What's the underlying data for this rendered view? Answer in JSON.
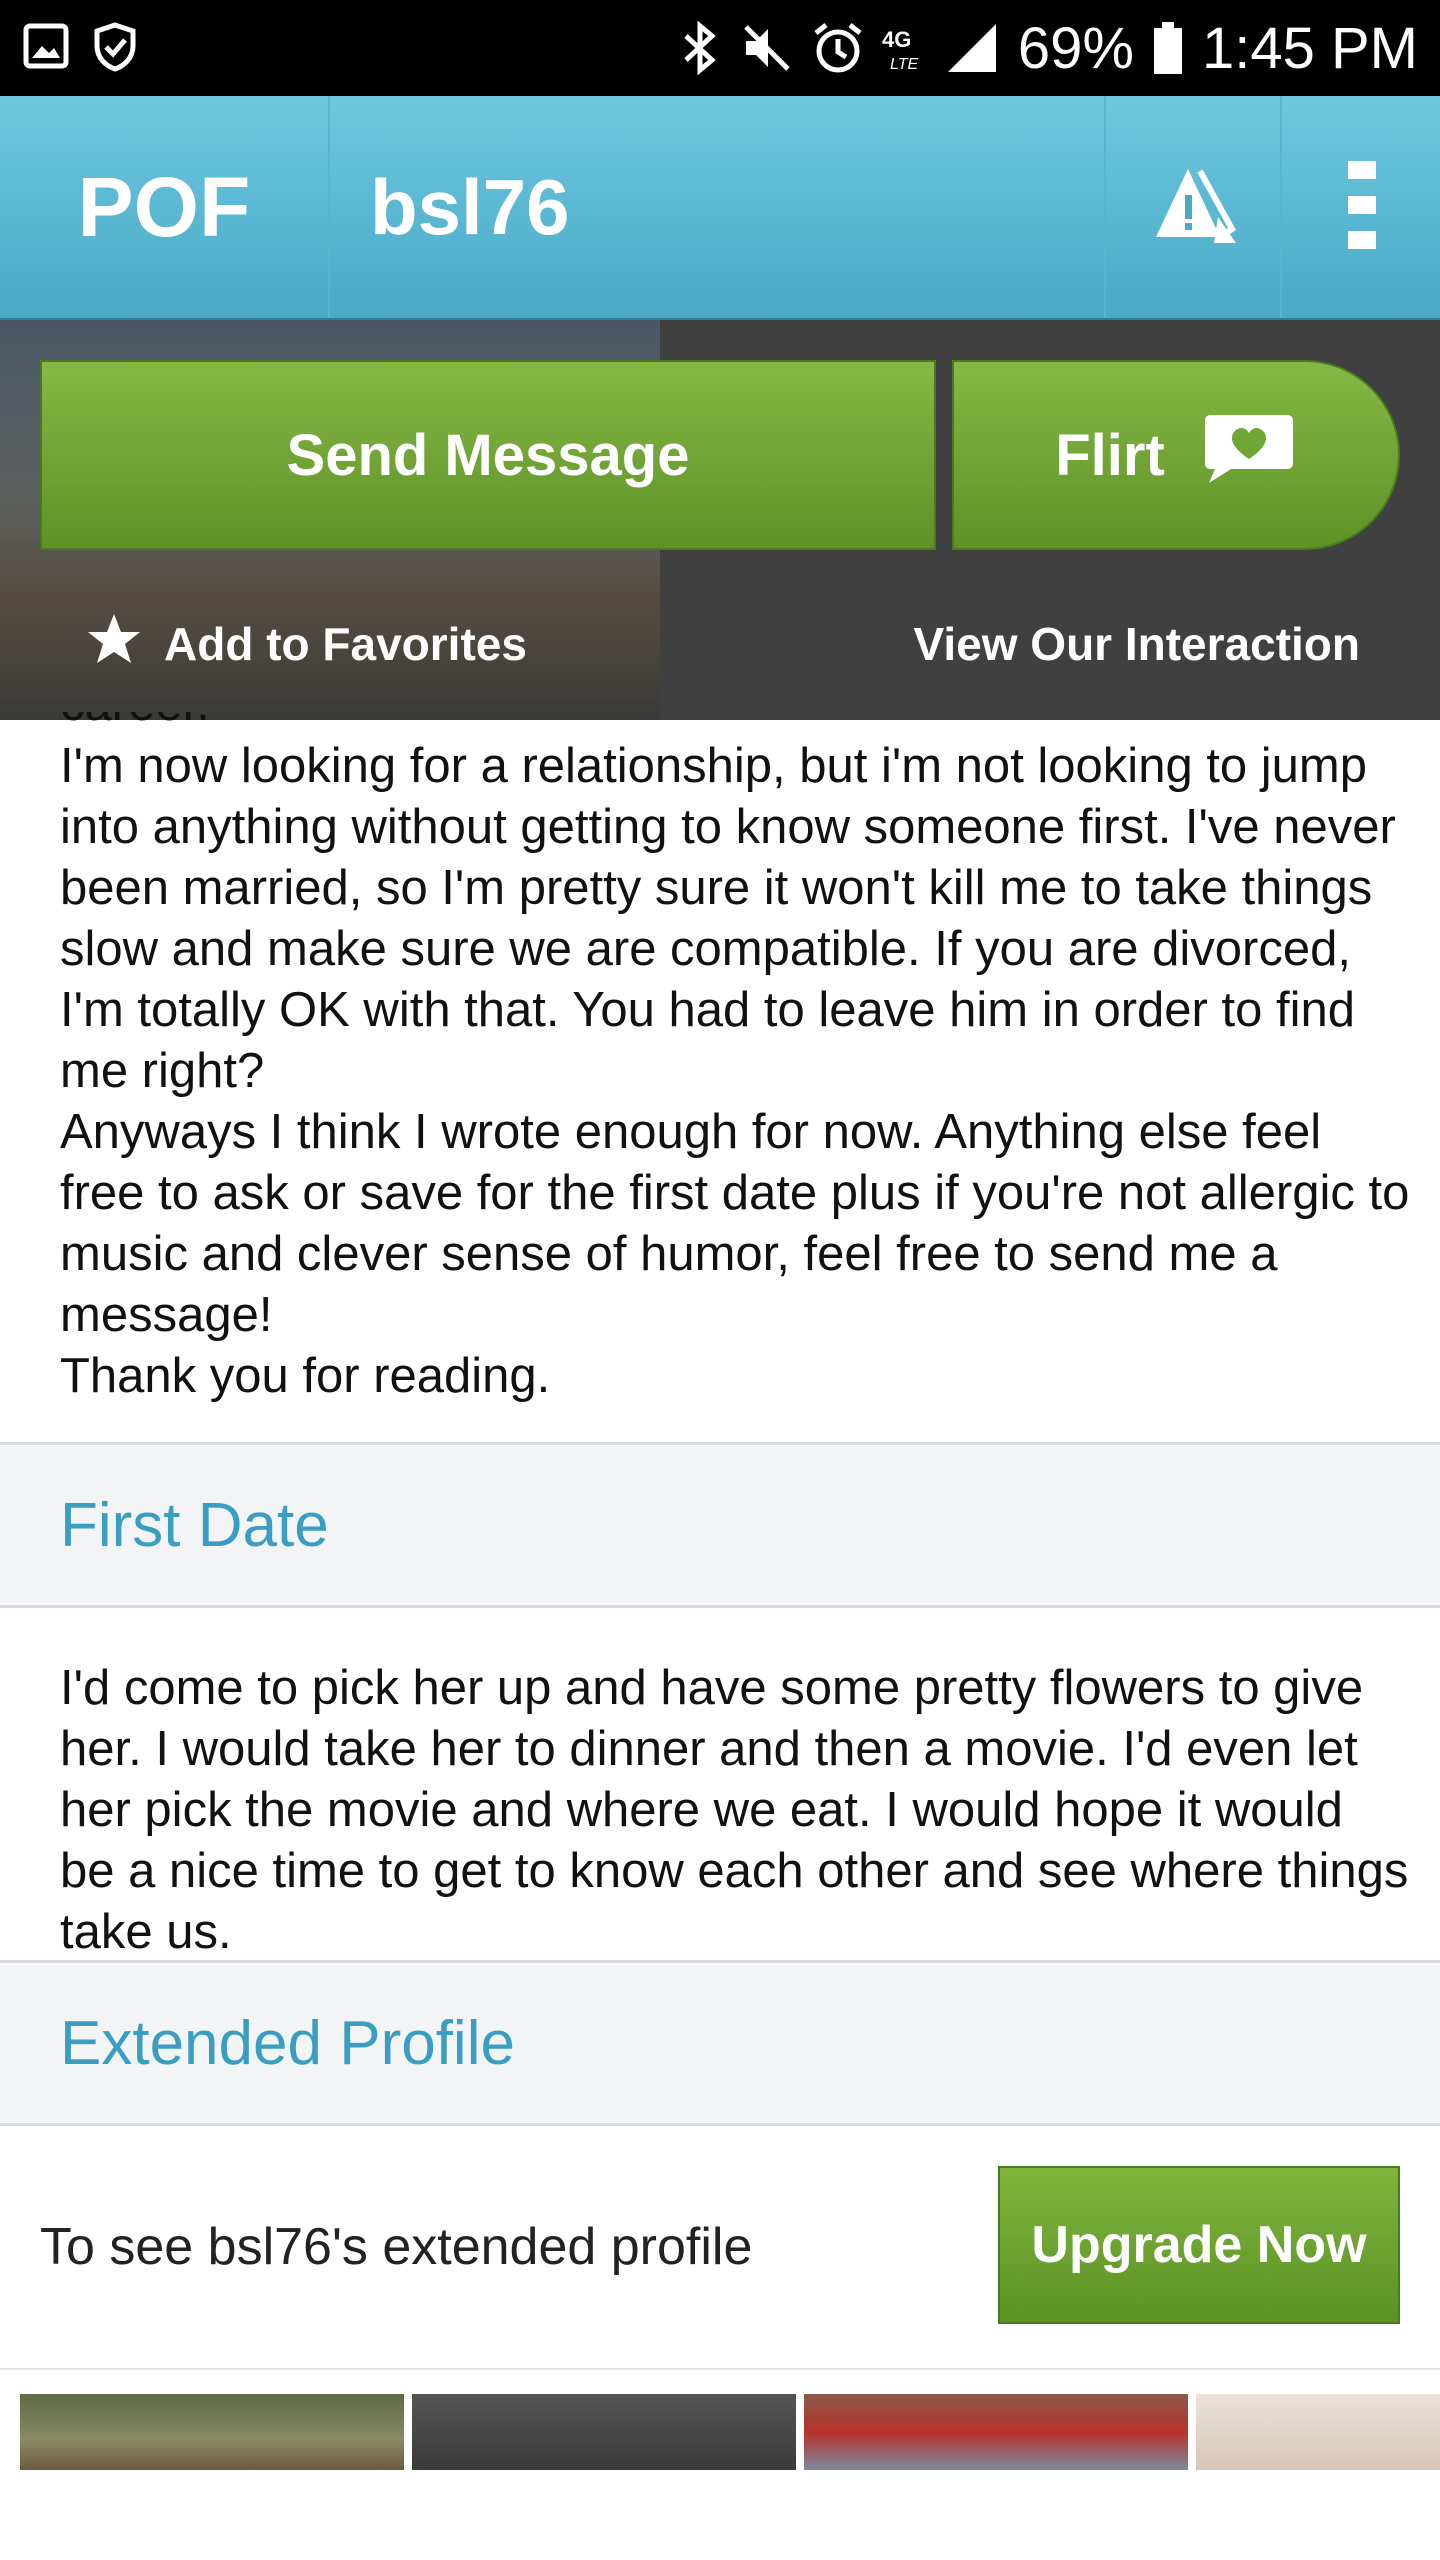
{
  "status_bar": {
    "battery": "69%",
    "time": "1:45 PM",
    "network": "4G LTE"
  },
  "app_bar": {
    "logo": "POF",
    "username": "bsl76"
  },
  "actions": {
    "send_message": "Send Message",
    "flirt": "Flirt",
    "add_favorites": "Add to Favorites",
    "view_interaction": "View Our Interaction"
  },
  "about": {
    "cut_line": "career.",
    "paragraphs": [
      "I'm now looking for a relationship, but i'm not looking to jump into anything without getting to know someone first. I've never been married, so I'm pretty sure it won't kill me to take things slow and make sure we are compatible. If you are divorced, I'm totally OK with that. You had to leave him in order to find me right?",
      "Anyways I think I wrote enough for now. Anything else feel free to ask or save for the first date plus if you're not allergic to music and clever sense of humor, feel free to send me a message!",
      "Thank you for reading."
    ]
  },
  "first_date": {
    "heading": "First Date",
    "text": "I'd come to pick her up and have some pretty flowers to give her. I would take her to dinner and then a movie. I'd even let her pick the movie and where we eat. I would hope it would be a nice time to get to know each other and see where things take us."
  },
  "extended_profile": {
    "heading": "Extended Profile",
    "prompt": "To see bsl76's extended profile",
    "upgrade_button": "Upgrade Now"
  },
  "colors": {
    "app_bar": "#58b6d2",
    "green_button": "#6fa634",
    "section_heading": "#3a9dc2",
    "section_bg": "#f3f4f5"
  }
}
